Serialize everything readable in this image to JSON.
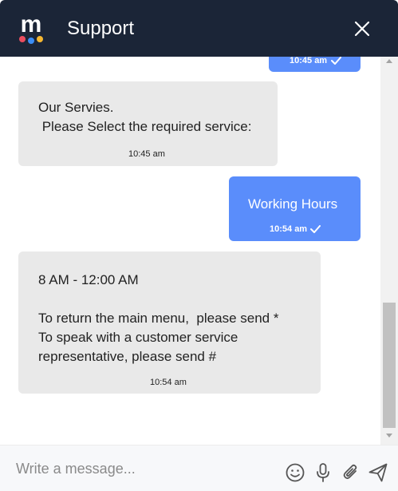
{
  "header": {
    "title": "Support",
    "logo_letter": "m"
  },
  "messages": [
    {
      "direction": "out",
      "text": "",
      "time": "10:45 am",
      "status": "sent"
    },
    {
      "direction": "in",
      "text": "Our Servies.\n Please Select the required service:",
      "time": "10:45 am"
    },
    {
      "direction": "out",
      "text": "Working Hours",
      "time": "10:54 am",
      "status": "sent"
    },
    {
      "direction": "in",
      "text": "8 AM - 12:00 AM\n\nTo return the main menu,  please send *\nTo speak with a customer service\nrepresentative, please send #",
      "time": "10:54 am"
    }
  ],
  "composer": {
    "placeholder": "Write a message...",
    "value": ""
  },
  "icons": {
    "close": "close-icon",
    "emoji": "emoji-icon",
    "mic": "microphone-icon",
    "attach": "paperclip-icon",
    "send": "send-icon",
    "tick": "check-icon"
  },
  "colors": {
    "header_bg": "#1b2537",
    "outgoing_bubble": "#5a8dfb",
    "incoming_bubble": "#e9e9e9",
    "logo_red": "#ea4d5f",
    "logo_blue": "#3c8ef6",
    "logo_yellow": "#f5b731"
  }
}
